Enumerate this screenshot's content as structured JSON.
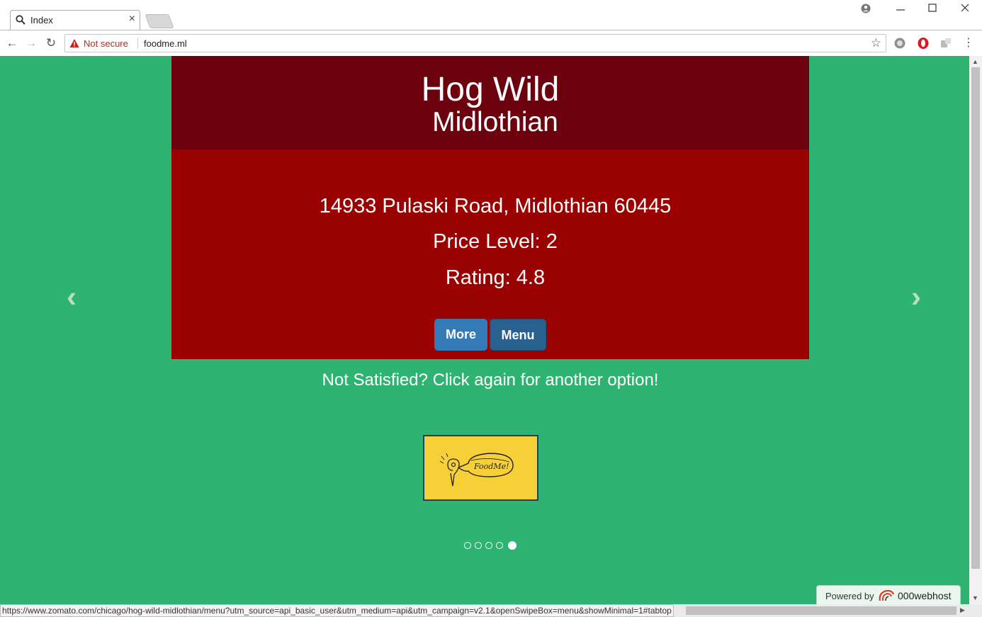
{
  "browser": {
    "tab_title": "Index",
    "tab_close": "×",
    "security_label": "Not secure",
    "url": "foodme.ml",
    "status_url": "https://www.zomato.com/chicago/hog-wild-midlothian/menu?utm_source=api_basic_user&utm_medium=api&utm_campaign=v2.1&openSwipeBox=menu&showMinimal=1#tabtop"
  },
  "restaurant": {
    "name": "Hog Wild",
    "city": "Midlothian",
    "address": "14933 Pulaski Road, Midlothian 60445",
    "price_level": "Price Level: 2",
    "rating": "Rating: 4.8"
  },
  "buttons": {
    "more": "More",
    "menu": "Menu"
  },
  "hint": "Not Satisfied? Click again for another option!",
  "logo_text": "FoodMe!",
  "carousel": {
    "slide_count": 5,
    "active_index": 4,
    "prev_glyph": "‹",
    "next_glyph": "›"
  },
  "footer": {
    "powered_label": "Powered by",
    "host_brand": "000webhost"
  },
  "colors": {
    "page_bg": "#2fb372",
    "header_bg": "#6c020e",
    "body_bg": "#9a0101",
    "more_button": "#337ab7",
    "menu_button": "#286090",
    "logo_bg": "#f7d038"
  }
}
